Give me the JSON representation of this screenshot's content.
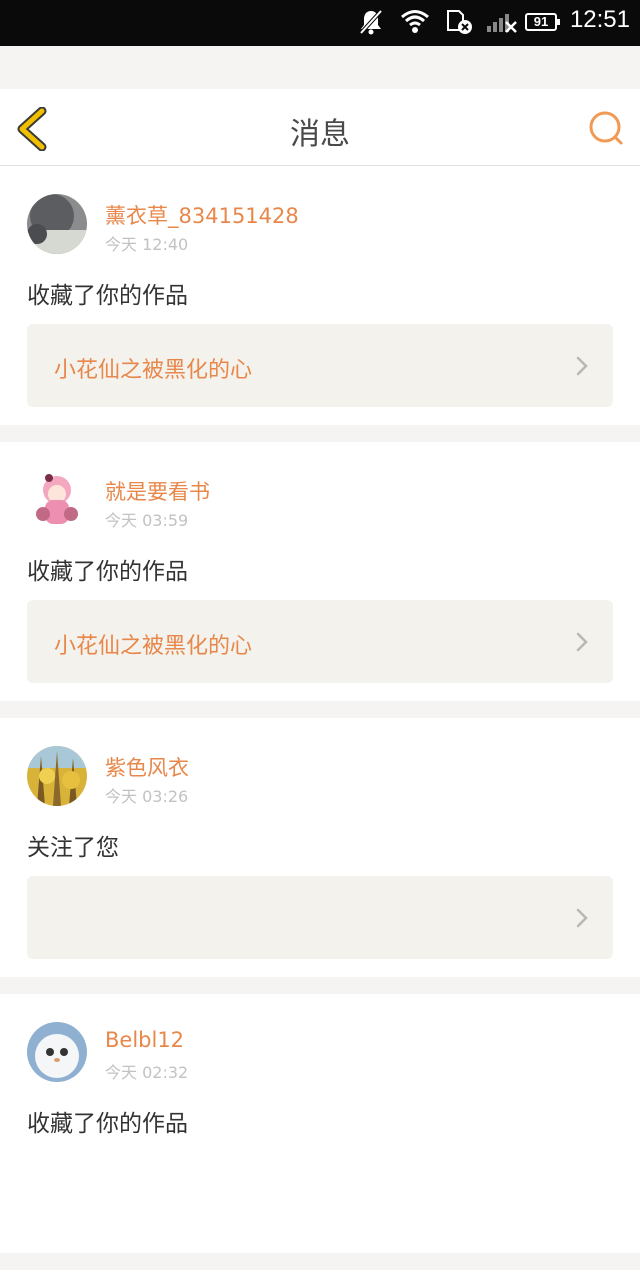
{
  "status_bar": {
    "time": "12:51",
    "battery": "91",
    "icons": [
      "mute-icon",
      "wifi-icon",
      "sim-off-icon",
      "signal-icon",
      "battery-icon"
    ]
  },
  "header": {
    "title": "消息",
    "back_icon": "chevron-left-icon",
    "search_icon": "search-icon"
  },
  "colors": {
    "accent": "#e8874a",
    "back_icon": "#f0c000",
    "background": "#f5f4f2",
    "box": "#f3f2ed"
  },
  "messages": [
    {
      "user": "薰衣草_834151428",
      "time": "今天 12:40",
      "action": "收藏了你的作品",
      "work": "小花仙之被黑化的心"
    },
    {
      "user": "就是要看书",
      "time": "今天 03:59",
      "action": "收藏了你的作品",
      "work": "小花仙之被黑化的心"
    },
    {
      "user": "紫色风衣",
      "time": "今天 03:26",
      "action": "关注了您",
      "work": ""
    },
    {
      "user": "Belbl12",
      "time": "今天 02:32",
      "action": "收藏了你的作品",
      "work": ""
    }
  ]
}
